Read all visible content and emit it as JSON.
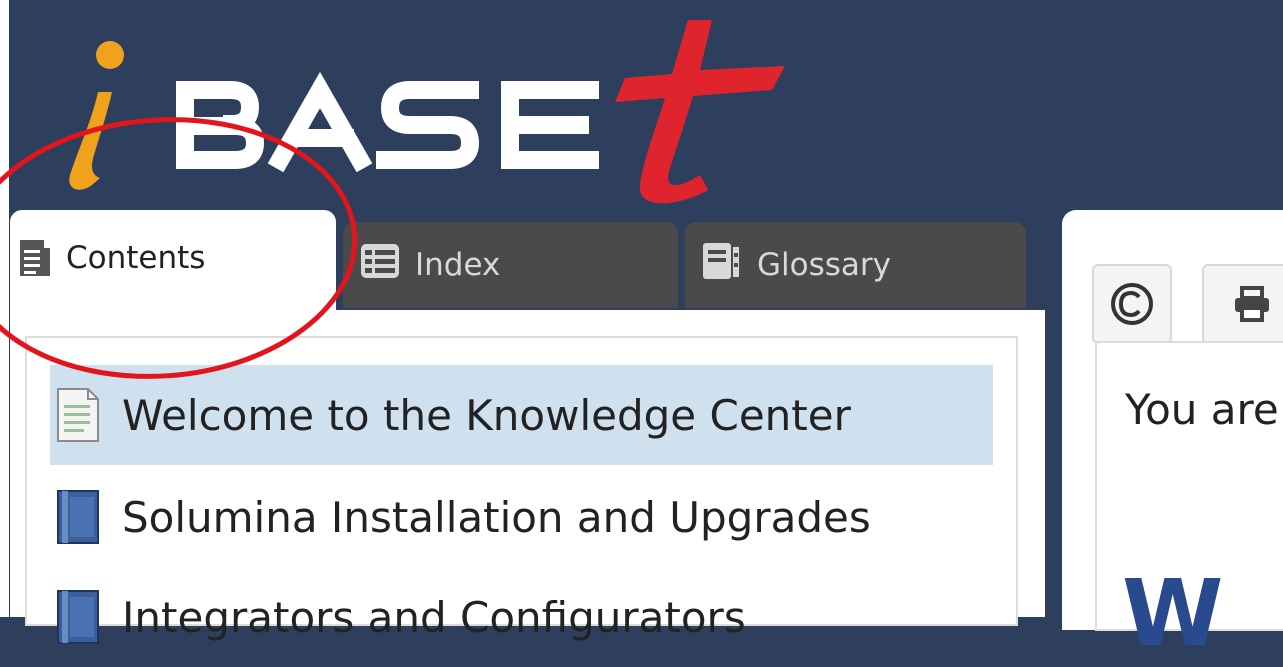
{
  "header": {
    "logo_text": "iBASEt"
  },
  "tabs": [
    {
      "label": "Contents",
      "active": true
    },
    {
      "label": "Index",
      "active": false
    },
    {
      "label": "Glossary",
      "active": false
    }
  ],
  "toc": {
    "items": [
      {
        "label": "Welcome to the Knowledge Center",
        "icon": "page-icon",
        "selected": true
      },
      {
        "label": "Solumina Installation and Upgrades",
        "icon": "book-icon",
        "selected": false
      },
      {
        "label": "Integrators and Configurators",
        "icon": "book-icon",
        "selected": false
      }
    ]
  },
  "toolbar": {
    "copyright_icon": "copyright-icon",
    "print_icon": "print-icon"
  },
  "content": {
    "intro_text": "You are",
    "heading": "W"
  },
  "colors": {
    "header_bg": "#2e3f5e",
    "tab_inactive_bg": "#4a4a4a",
    "selected_row_bg": "#cfe0ef",
    "logo_orange": "#f0a21d",
    "logo_red": "#e0242e",
    "annotation_red": "#e3141b"
  }
}
